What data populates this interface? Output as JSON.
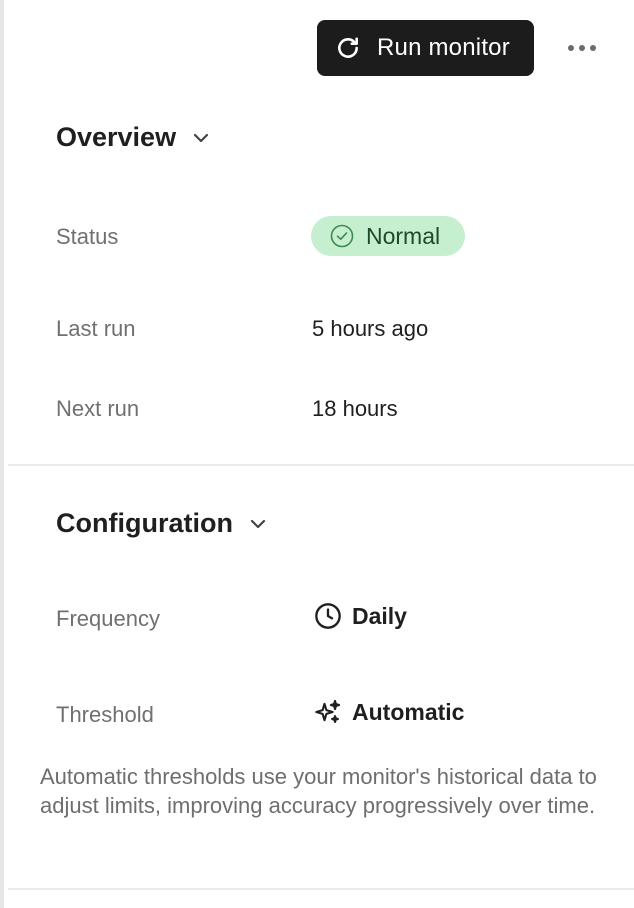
{
  "header": {
    "run_button_label": "Run monitor",
    "run_icon": "refresh-icon",
    "more_icon": "more-horizontal-icon"
  },
  "overview": {
    "title": "Overview",
    "status_label": "Status",
    "status_value": "Normal",
    "status_color": "#c6efcf",
    "last_run_label": "Last run",
    "last_run_value": "5 hours ago",
    "next_run_label": "Next run",
    "next_run_value": "18 hours"
  },
  "configuration": {
    "title": "Configuration",
    "frequency_label": "Frequency",
    "frequency_value": "Daily",
    "frequency_icon": "clock-icon",
    "threshold_label": "Threshold",
    "threshold_value": "Automatic",
    "threshold_icon": "sparkle-icon",
    "threshold_note": "Automatic thresholds use your monitor's historical data to adjust limits, improving accuracy progressively over time."
  }
}
